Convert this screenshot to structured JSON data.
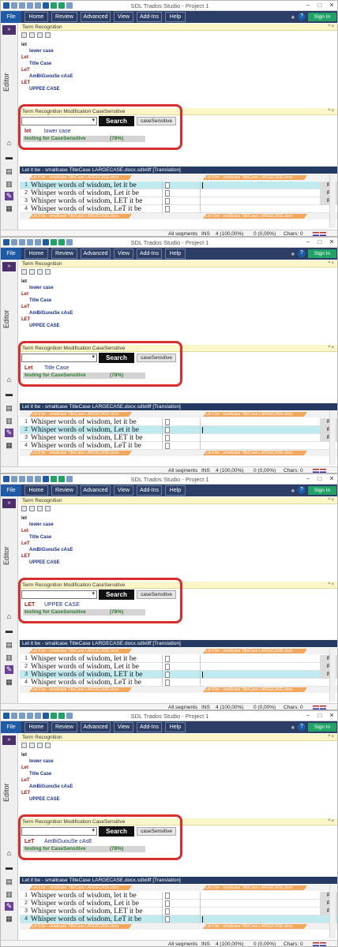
{
  "window": {
    "title": "SDL Trados Studio - Project 1"
  },
  "ribbon": {
    "file": "File",
    "tabs": [
      "Home",
      "Review",
      "Advanced",
      "View",
      "Add-Ins",
      "Help"
    ],
    "help_glyph": "?",
    "signin": "Sign In"
  },
  "sidebar": {
    "expand_glyph": "»",
    "label": "Editor"
  },
  "term_recognition": {
    "title": "Term Recognition",
    "pin": "ª ×",
    "entries": [
      {
        "src": "let",
        "tgt": "lower case"
      },
      {
        "src": "Let",
        "tgt": "Title Case"
      },
      {
        "src": "LeT",
        "tgt": "AmBiGuouSe cAsE"
      },
      {
        "src": "LET",
        "tgt": "UPPEE CASE"
      }
    ]
  },
  "modification": {
    "title": "Term Recognition Modification CaseSensitive",
    "pin": "ª ×",
    "search_button": "Search",
    "case_button": "caseSensitive",
    "result_label": "testing for CaseSensitive",
    "result_pct": "(78%)"
  },
  "editor": {
    "title": "Let it be - smallcase TitleCase LARGECASE.docx.sdlxliff [Translation]",
    "tag_text": "Let it be - smallcase TitleCase LARGECASE.docx",
    "p_label": "P"
  },
  "status": {
    "filter": "All segments",
    "mode": "INS",
    "count1": "4 (100,00%)",
    "count2": "0 (0,00%)",
    "chars": "Chars: 0"
  },
  "frames": [
    {
      "active": 1,
      "result_src": "let",
      "result_tgt": "lower case",
      "segments": [
        "Whisper words of wisdom, let it be",
        "Whisper words of wisdom, Let it be",
        "Whisper words of wisdom, LET it be",
        "Whisper words of wisdom, LeT it be"
      ]
    },
    {
      "active": 2,
      "result_src": "Let",
      "result_tgt": "Title Case",
      "segments": [
        "Whisper words of wisdom, let it be",
        "Whisper words of wisdom, Let it be",
        "Whisper words of wisdom, LET it be",
        "Whisper words of wisdom, LeT it be"
      ]
    },
    {
      "active": 3,
      "result_src": "LET",
      "result_tgt": "UPPEE CASE",
      "segments": [
        "Whisper words of wisdom, let it be",
        "Whisper words of wisdom, Let it be",
        "Whisper words of wisdom, LET it be",
        "Whisper words of wisdom, LeT it be"
      ]
    },
    {
      "active": 4,
      "result_src": "LeT",
      "result_tgt": "AmBiGuouSe cAsE",
      "segments": [
        "Whisper words of wisdom, let it be",
        "Whisper words of wisdom, Let it be",
        "Whisper words of wisdom, LET it be",
        "Whisper words of wisdom, LeT it be"
      ]
    }
  ],
  "colors": {
    "ribbon": "#2c3e66",
    "file": "#1f5aa6",
    "signin": "#21a366",
    "highlight": "#d92e2e",
    "active_row": "#bfeaf0",
    "tag": "#f1a75c"
  }
}
